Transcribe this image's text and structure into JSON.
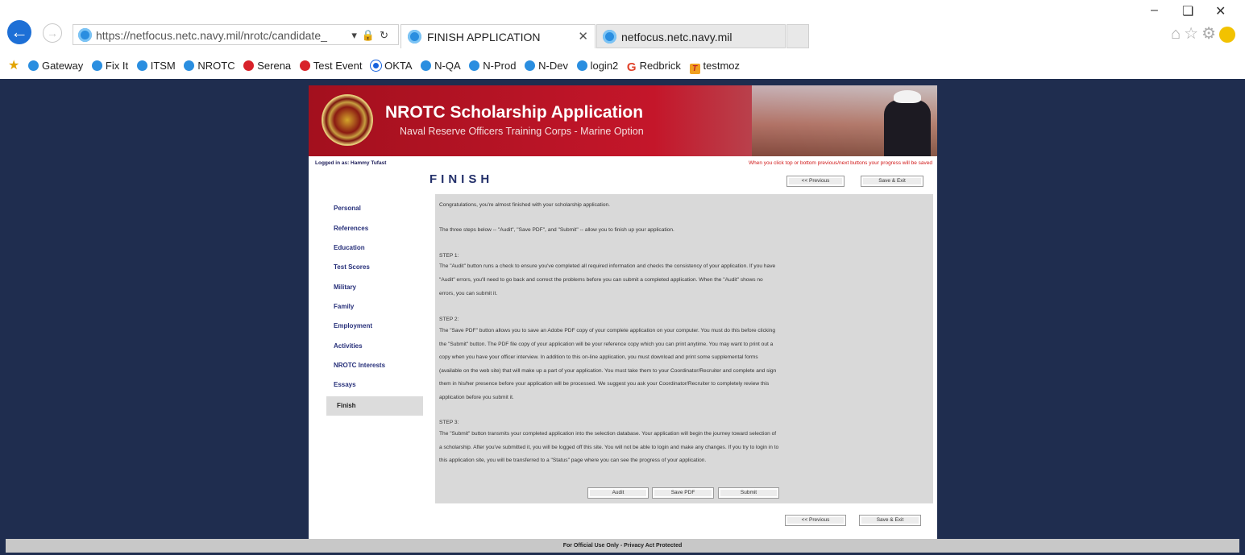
{
  "browser": {
    "url": "https://netfocus.netc.navy.mil/nrotc/candidate_",
    "tabs": [
      {
        "label": "FINISH APPLICATION"
      },
      {
        "label": "netfocus.netc.navy.mil"
      }
    ],
    "favorites": [
      "Gateway",
      "Fix It",
      "ITSM",
      "NROTC",
      "Serena",
      "Test Event",
      "OKTA",
      "N-QA",
      "N-Prod",
      "N-Dev",
      "login2",
      "Redbrick",
      "testmoz"
    ]
  },
  "page": {
    "title": "NROTC Scholarship Application",
    "subtitle": "Naval Reserve Officers Training Corps - Marine Option",
    "logged_in": "Logged in as: Hammy Tufast",
    "save_note": "When you click top or bottom previous/next buttons your progress will be saved",
    "section_title": "FINISH",
    "buttons": {
      "previous": "<< Previous",
      "save_exit": "Save & Exit",
      "audit": "Audit",
      "save_pdf": "Save PDF",
      "submit": "Submit"
    },
    "sidebar": [
      "Personal",
      "References",
      "Education",
      "Test Scores",
      "Military",
      "Family",
      "Employment",
      "Activities",
      "NROTC Interests",
      "Essays"
    ],
    "sidebar_active": "Finish",
    "content": {
      "intro1": "Congratulations, you're almost finished with your scholarship application.",
      "intro2": "The three steps below -- \"Audit\", \"Save PDF\", and \"Submit\" -- allow you to finish up your application.",
      "step1_label": "STEP 1:",
      "step1_lines": [
        "The \"Audit\" button runs a check to ensure you've completed all required information and checks the consistency of your application. If you have",
        "\"Audit\" errors, you'll need to go back and correct the problems before you can submit a completed application. When the \"Audit\" shows no",
        "errors, you can submit it."
      ],
      "step2_label": "STEP 2:",
      "step2_lines": [
        "The \"Save PDF\" button allows you to save an Adobe PDF copy of your complete application on your computer. You must do this before clicking",
        "the \"Submit\" button. The PDF file copy of your application will be your reference copy which you can print anytime. You may want to print out a",
        "copy when you have your officer interview. In addition to this on-line application, you must download and print some supplemental forms",
        "(available on the web site) that will make up a part of your application. You must take them to your Coordinator/Recruiter and complete and sign",
        "them in his/her presence before your application will be processed. We suggest you ask your Coordinator/Recruiter to completely review this",
        "application before you submit it."
      ],
      "step3_label": "STEP 3:",
      "step3_lines": [
        "The \"Submit\" button transmits your completed application into the selection database. Your application will begin the journey toward selection of",
        "a scholarship. After you've submitted it, you will be logged off this site. You will not be able to login and make any changes. If you try to login in to",
        "this application site, you will be transferred to a \"Status\" page where you can see the progress of your application."
      ]
    },
    "footer": "For Official Use Only - Privacy Act Protected"
  },
  "colors": {
    "background": "#1f2d4f",
    "banner": "#c4162a",
    "content_bg": "#d9d9d9",
    "nav_text": "#27307a",
    "warning": "#d01818"
  },
  "icons": [
    "back-arrow-icon",
    "forward-arrow-icon",
    "lock-icon",
    "refresh-icon",
    "home-icon",
    "star-icon",
    "gear-icon",
    "smiley-icon"
  ]
}
